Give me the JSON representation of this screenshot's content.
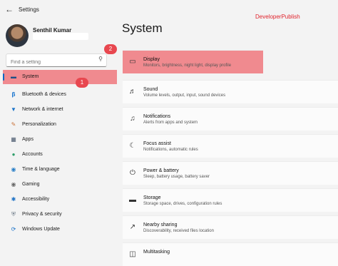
{
  "window": {
    "title": "Settings",
    "back_icon": "arrow-left"
  },
  "watermark": "DeveloperPublish",
  "user": {
    "name": "Senthil Kumar"
  },
  "search": {
    "placeholder": "Find a setting"
  },
  "badges": {
    "one": "1",
    "two": "2"
  },
  "sidebar": {
    "items": [
      {
        "label": "System",
        "icon": "monitor-icon",
        "active": true
      },
      {
        "label": "Bluetooth & devices",
        "icon": "bluetooth-icon"
      },
      {
        "label": "Network & internet",
        "icon": "wifi-icon"
      },
      {
        "label": "Personalization",
        "icon": "brush-icon"
      },
      {
        "label": "Apps",
        "icon": "apps-icon"
      },
      {
        "label": "Accounts",
        "icon": "person-icon"
      },
      {
        "label": "Time & language",
        "icon": "globe-clock-icon"
      },
      {
        "label": "Gaming",
        "icon": "gamepad-icon"
      },
      {
        "label": "Accessibility",
        "icon": "accessibility-icon"
      },
      {
        "label": "Privacy & security",
        "icon": "shield-icon"
      },
      {
        "label": "Windows Update",
        "icon": "update-icon"
      }
    ]
  },
  "main": {
    "title": "System",
    "cards": [
      {
        "title": "Display",
        "subtitle": "Monitors, brightness, night light, display profile",
        "icon": "display-icon"
      },
      {
        "title": "Sound",
        "subtitle": "Volume levels, output, input, sound devices",
        "icon": "speaker-icon"
      },
      {
        "title": "Notifications",
        "subtitle": "Alerts from apps and system",
        "icon": "bell-icon"
      },
      {
        "title": "Focus assist",
        "subtitle": "Notifications, automatic rules",
        "icon": "moon-icon"
      },
      {
        "title": "Power & battery",
        "subtitle": "Sleep, battery usage, battery saver",
        "icon": "power-icon"
      },
      {
        "title": "Storage",
        "subtitle": "Storage space, drives, configuration rules",
        "icon": "storage-icon"
      },
      {
        "title": "Nearby sharing",
        "subtitle": "Discoverability, received files location",
        "icon": "share-icon"
      },
      {
        "title": "Multitasking",
        "subtitle": "",
        "icon": "multitask-icon"
      }
    ]
  },
  "colors": {
    "highlight": "#f08a8f",
    "badge": "#e8474f",
    "accent": "#1066c2",
    "watermark": "#e0242d"
  }
}
